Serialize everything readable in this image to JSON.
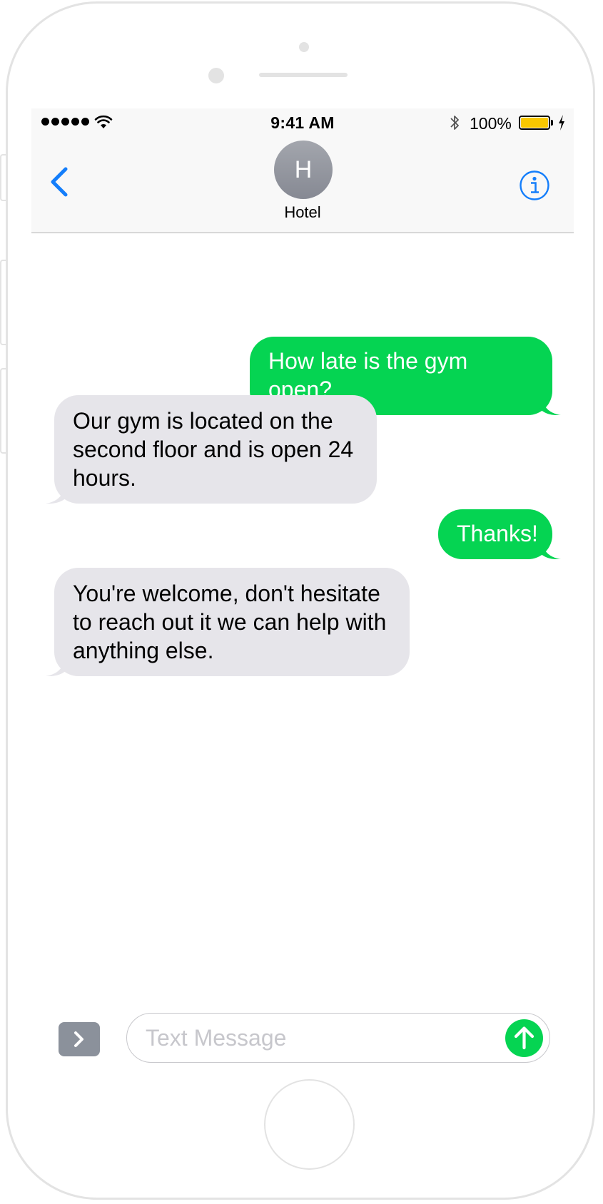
{
  "status_bar": {
    "time": "9:41 AM",
    "battery_percent": "100%",
    "battery_level": 1.0,
    "signal_bars": 5,
    "icons": [
      "wifi-icon",
      "bluetooth-icon",
      "battery-icon",
      "charging-icon"
    ]
  },
  "nav": {
    "back_icon": "chevron-left-icon",
    "avatar_initial": "H",
    "contact_name": "Hotel",
    "info_icon": "info-icon"
  },
  "messages": [
    {
      "direction": "sent",
      "text": "How late is the gym open?"
    },
    {
      "direction": "received",
      "text": "Our gym is located on the second floor and is open 24 hours."
    },
    {
      "direction": "sent",
      "text": "Thanks!"
    },
    {
      "direction": "received",
      "text": "You're welcome, don't hesitate to reach out it we can help with anything else."
    }
  ],
  "composer": {
    "apps_icon": "chevron-right-icon",
    "placeholder": "Text Message",
    "value": "",
    "send_icon": "arrow-up-icon"
  },
  "colors": {
    "sent_bubble": "#05d452",
    "received_bubble": "#e6e5ea",
    "accent": "#147efb",
    "battery": "#f8c700"
  }
}
